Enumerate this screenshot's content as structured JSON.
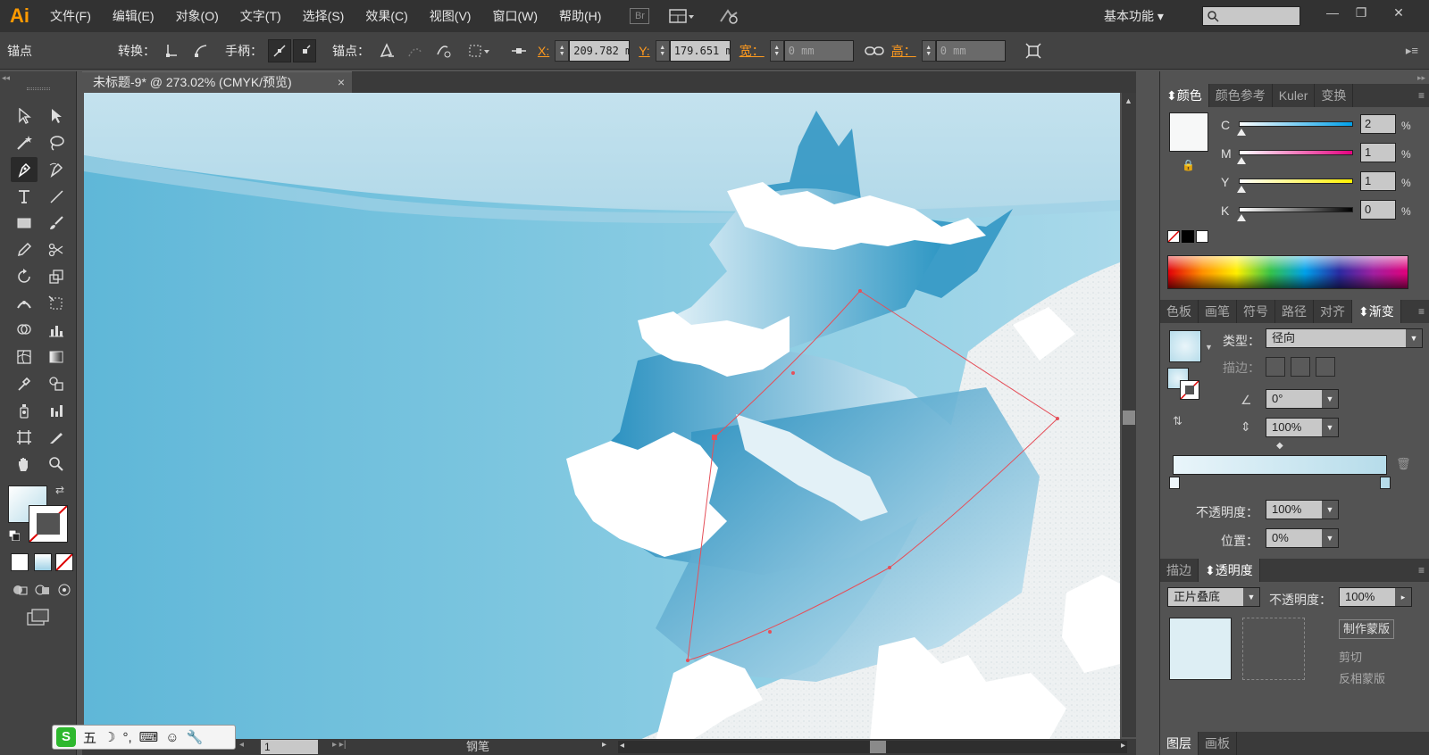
{
  "app": {
    "logo": "Ai",
    "bridge": "Br",
    "workspace": "基本功能 ▾"
  },
  "menu": [
    "文件(F)",
    "编辑(E)",
    "对象(O)",
    "文字(T)",
    "选择(S)",
    "效果(C)",
    "视图(V)",
    "窗口(W)",
    "帮助(H)"
  ],
  "control": {
    "mode": "锚点",
    "convert_label": "转换：",
    "handle_label": "手柄：",
    "anchor_label": "锚点：",
    "x_label": "X:",
    "x_value": "209.782 m",
    "y_label": "Y:",
    "y_value": "179.651 m",
    "w_label": "宽：",
    "w_value": "0 mm",
    "h_label": "高：",
    "h_value": "0 mm"
  },
  "document": {
    "tab_title": "未标题-9* @ 273.02% (CMYK/预览)",
    "close": "×"
  },
  "status": {
    "zoom": "1",
    "tool": "钢笔"
  },
  "color_panel": {
    "tabs": [
      "颜色",
      "颜色参考",
      "Kuler",
      "变换"
    ],
    "channels": [
      {
        "label": "C",
        "value": "2",
        "color": "#00a0e9"
      },
      {
        "label": "M",
        "value": "1",
        "color": "#e4007f"
      },
      {
        "label": "Y",
        "value": "1",
        "color": "#fff100"
      },
      {
        "label": "K",
        "value": "0",
        "color": "#000000"
      }
    ],
    "pct": "%"
  },
  "gradient_panel": {
    "tabs": [
      "色板",
      "画笔",
      "符号",
      "路径",
      "对齐",
      "渐变"
    ],
    "type_label": "类型：",
    "type_value": "径向",
    "stroke_label": "描边：",
    "angle_value": "0°",
    "aspect_value": "100%",
    "opacity_label": "不透明度：",
    "opacity_value": "100%",
    "location_label": "位置：",
    "location_value": "0%"
  },
  "transparency_panel": {
    "tabs": [
      "描边",
      "透明度"
    ],
    "blend_value": "正片叠底",
    "opacity_label": "不透明度：",
    "opacity_value": "100%",
    "make_mask": "制作蒙版",
    "clip": "剪切",
    "invert": "反相蒙版"
  },
  "layers_panel": {
    "tabs": [
      "图层",
      "画板"
    ]
  },
  "ime": {
    "mode": "五"
  }
}
